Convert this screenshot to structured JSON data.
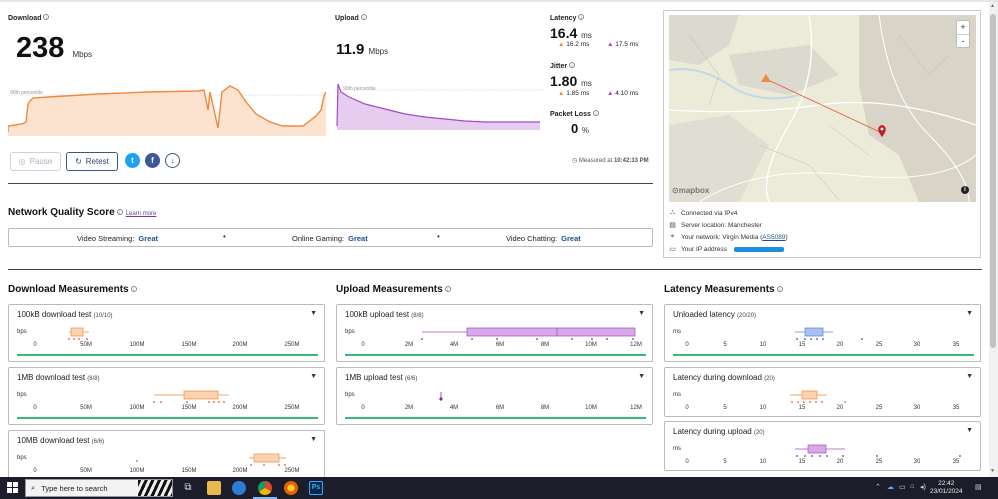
{
  "download": {
    "label": "Download",
    "value": "238",
    "unit": "Mbps",
    "chart_annotation": "90th percentile"
  },
  "upload": {
    "label": "Upload",
    "value": "11.9",
    "unit": "Mbps",
    "chart_annotation": "90th percentile"
  },
  "latency": {
    "label": "Latency",
    "value": "16.4",
    "unit": "ms",
    "down": "16.2 ms",
    "up": "17.5 ms"
  },
  "jitter": {
    "label": "Jitter",
    "value": "1.80",
    "unit": "ms",
    "down": "1.85 ms",
    "up": "4.10 ms"
  },
  "packet_loss": {
    "label": "Packet Loss",
    "value": "0",
    "unit": "%"
  },
  "controls": {
    "pause_label": "Pause",
    "retest_label": "Retest",
    "measured_prefix": "Measured at",
    "measured_time": "10:42:33 PM"
  },
  "network_quality": {
    "title": "Network Quality Score",
    "learn_more": "Learn more",
    "items": [
      {
        "label": "Video Streaming:",
        "value": "Great"
      },
      {
        "label": "Online Gaming:",
        "value": "Great"
      },
      {
        "label": "Video Chatting:",
        "value": "Great"
      }
    ]
  },
  "map": {
    "attribution": "mapbox",
    "zoom_in": "+",
    "zoom_out": "-"
  },
  "connection": {
    "via": "Connected via IPv4",
    "server": "Server location: Manchester",
    "network_prefix": "Your network: Virgin Media (",
    "asn": "AS5089",
    "network_suffix": ")",
    "ip_label": "Your IP address"
  },
  "sections": {
    "download_measurements": "Download Measurements",
    "upload_measurements": "Upload Measurements",
    "latency_measurements": "Latency Measurements"
  },
  "cards": {
    "dl_100k": {
      "title": "100kB download test",
      "count": "(10/10)",
      "unit": "bps"
    },
    "dl_1m": {
      "title": "1MB download test",
      "count": "(8/8)",
      "unit": "bps"
    },
    "dl_10m": {
      "title": "10MB download test",
      "count": "(6/6)",
      "unit": "bps"
    },
    "ul_100k": {
      "title": "100kB upload test",
      "count": "(8/8)",
      "unit": "bps"
    },
    "ul_1m": {
      "title": "1MB upload test",
      "count": "(6/6)",
      "unit": "bps"
    },
    "lat_unloaded": {
      "title": "Unloaded latency",
      "count": "(20/20)",
      "unit": "ms"
    },
    "lat_down": {
      "title": "Latency during download",
      "count": "(20)",
      "unit": "ms"
    },
    "lat_up": {
      "title": "Latency during upload",
      "count": "(20)",
      "unit": "ms"
    }
  },
  "axes": {
    "download": [
      "0",
      "50M",
      "100M",
      "150M",
      "200M",
      "250M"
    ],
    "upload": [
      "0",
      "2M",
      "4M",
      "6M",
      "8M",
      "10M",
      "12M"
    ],
    "latency": [
      "0",
      "5",
      "10",
      "15",
      "20",
      "25",
      "30",
      "35"
    ]
  },
  "colors": {
    "download": "#f08a3e",
    "upload": "#a24bc2",
    "latency": "#5b86d6",
    "great": "#1f4f8f",
    "bar_green": "#3bb77e"
  },
  "taskbar": {
    "search_placeholder": "Type here to search",
    "time": "22:42",
    "date": "23/01/2024"
  }
}
